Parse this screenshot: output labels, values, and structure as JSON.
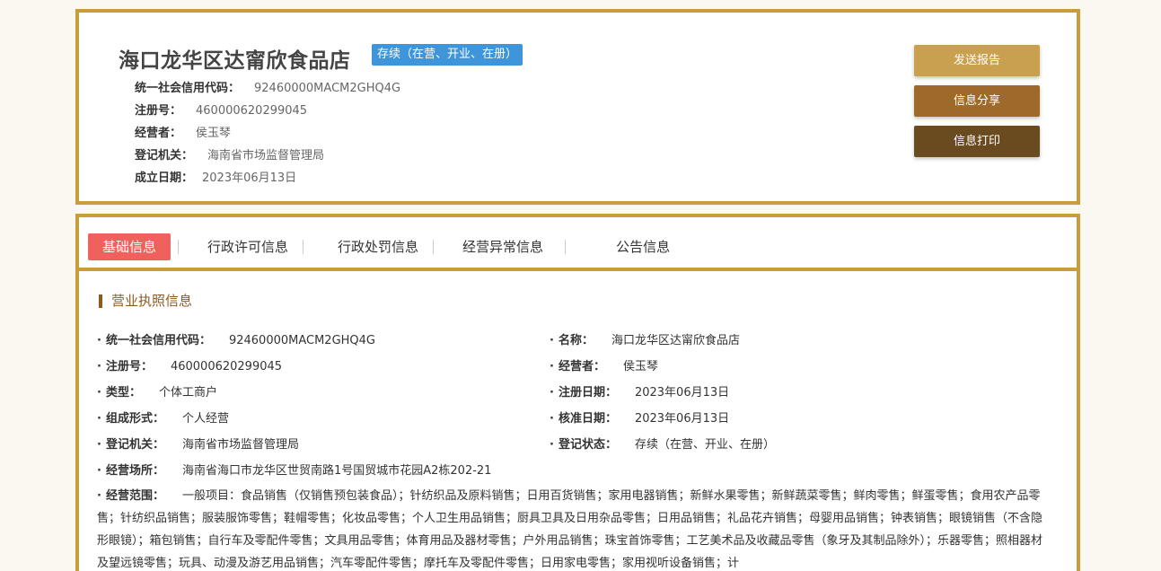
{
  "company": {
    "name": "海口龙华区达甯欣食品店",
    "status": "存续（在营、开业、在册）",
    "meta": [
      {
        "label": "统一社会信用代码：",
        "value": "92460000MACM2GHQ4G"
      },
      {
        "label": "注册号：",
        "value": "460000620299045"
      },
      {
        "label": "经营者：",
        "value": "侯玉琴"
      },
      {
        "label": "登记机关：",
        "value": "海南省市场监督管理局"
      },
      {
        "label": "成立日期：",
        "value": "2023年06月13日"
      }
    ]
  },
  "actions": {
    "report": "发送报告",
    "share": "信息分享",
    "print": "信息打印"
  },
  "tabs": [
    "基础信息",
    "行政许可信息",
    "行政处罚信息",
    "经营异常信息",
    "公告信息"
  ],
  "section": {
    "title": "营业执照信息",
    "left": [
      {
        "label": "统一社会信用代码：",
        "value": "92460000MACM2GHQ4G"
      },
      {
        "label": "注册号：",
        "value": "460000620299045"
      },
      {
        "label": "类型：",
        "value": "个体工商户"
      },
      {
        "label": "组成形式：",
        "value": "个人经营"
      },
      {
        "label": "登记机关：",
        "value": "海南省市场监督管理局"
      },
      {
        "label": "经营场所：",
        "value": "海南省海口市龙华区世贸南路1号国贸城市花园A2栋202-21"
      }
    ],
    "right": [
      {
        "label": "名称：",
        "value": "海口龙华区达甯欣食品店"
      },
      {
        "label": "经营者：",
        "value": "侯玉琴"
      },
      {
        "label": "注册日期：",
        "value": "2023年06月13日"
      },
      {
        "label": "核准日期：",
        "value": "2023年06月13日"
      },
      {
        "label": "登记状态：",
        "value": "存续（在营、开业、在册）"
      }
    ],
    "scope": {
      "label": "经营范围：",
      "value": "一般项目：食品销售（仅销售预包装食品）；针纺织品及原料销售；日用百货销售；家用电器销售；新鲜水果零售；新鲜蔬菜零售；鲜肉零售；鲜蛋零售；食用农产品零售；针纺织品销售；服装服饰零售；鞋帽零售；化妆品零售；个人卫生用品销售；厨具卫具及日用杂品零售；日用品销售；礼品花卉销售；母婴用品销售；钟表销售；眼镜销售（不含隐形眼镜）；箱包销售；自行车及零配件零售；文具用品零售；体育用品及器材零售；户外用品销售；珠宝首饰零售；工艺美术品及收藏品零售（象牙及其制品除外）；乐器零售；照相器材及望远镜零售；玩具、动漫及游艺用品销售；汽车零配件零售；摩托车及零配件零售；日用家电零售；家用视听设备销售；计"
    }
  }
}
